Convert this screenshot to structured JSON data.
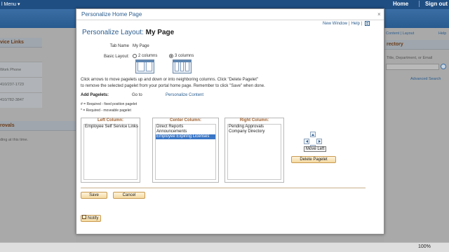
{
  "portal": {
    "menu_label": "l Menu ▾",
    "home_label": "Home",
    "signout_label": "Sign out",
    "left_panel1_title": "vice Links",
    "left_phone_header": "Work Phone",
    "left_phone1": "410/237-1723",
    "left_phone2": "410/782-3847",
    "left_panel2_title": "rovals",
    "left_panel2_text": "ding at this time.",
    "right_links": "Content | Layout",
    "right_help": "Help",
    "right_panel_title": "rectory",
    "right_search_hint": "Title, Department, or Email",
    "right_adv_search": "Advanced Search",
    "zoom": "100%"
  },
  "modal": {
    "title": "Personalize Home Page",
    "close": "×",
    "new_window": "New Window",
    "help": "Help",
    "heading_prefix": "Personalize Layout:",
    "heading_page": "My Page",
    "tab_name_label": "Tab Name",
    "tab_name_value": "My Page",
    "basic_layout_label": "Basic Layout:",
    "two_columns": "2 columns",
    "three_columns": "3 columns",
    "instructions1": "Click arrows to move pagelets up and down or into neighboring columns. Click \"Delete Pagelet\"",
    "instructions2": "to remove the selected pagelet from your portal home page. Remember to click \"Save\" when done.",
    "add_pagelets_label": "Add Pagelets:",
    "go_to": "Go to",
    "personalize_content": "Personalize Content",
    "legend_fixed": "# = Required - fixed position pagelet",
    "legend_moveable": "* = Required - moveable pagelet",
    "left_column": {
      "header": "Left Column:",
      "items": [
        "Employee Self Service Links"
      ]
    },
    "center_column": {
      "header": "Center Column:",
      "items": [
        "Direct Reports",
        "Announcements",
        "Employee Expiring Licenses"
      ],
      "selected_index": 2
    },
    "right_column": {
      "header": "Right Column:",
      "items": [
        "Pending Approvals",
        "Company Directory"
      ]
    },
    "move_left_tooltip": "Move Left",
    "delete_pagelet": "Delete Pagelet",
    "save": "Save",
    "cancel": "Cancel",
    "notify": "Notify"
  }
}
